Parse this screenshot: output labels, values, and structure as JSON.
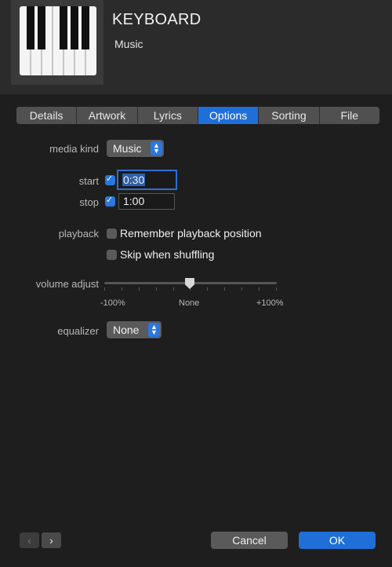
{
  "header": {
    "title": "KEYBOARD",
    "subtitle": "Music",
    "artwork_icon": "piano-keys-artwork"
  },
  "tabs": [
    {
      "label": "Details",
      "active": false
    },
    {
      "label": "Artwork",
      "active": false
    },
    {
      "label": "Lyrics",
      "active": false
    },
    {
      "label": "Options",
      "active": true
    },
    {
      "label": "Sorting",
      "active": false
    },
    {
      "label": "File",
      "active": false
    }
  ],
  "options": {
    "media_kind_label": "media kind",
    "media_kind_value": "Music",
    "start_label": "start",
    "start_checked": true,
    "start_value": "0:30",
    "stop_label": "stop",
    "stop_checked": true,
    "stop_value": "1:00",
    "playback_label": "playback",
    "remember_label": "Remember playback position",
    "remember_checked": false,
    "skip_label": "Skip when shuffling",
    "skip_checked": false,
    "volume_label": "volume adjust",
    "volume_min": "-100%",
    "volume_mid": "None",
    "volume_max": "+100%",
    "volume_value": 0,
    "equalizer_label": "equalizer",
    "equalizer_value": "None"
  },
  "footer": {
    "prev_icon": "chevron-left-icon",
    "next_icon": "chevron-right-icon",
    "cancel_label": "Cancel",
    "ok_label": "OK"
  },
  "colors": {
    "accent": "#1f6fd8",
    "background": "#1e1e1e"
  }
}
